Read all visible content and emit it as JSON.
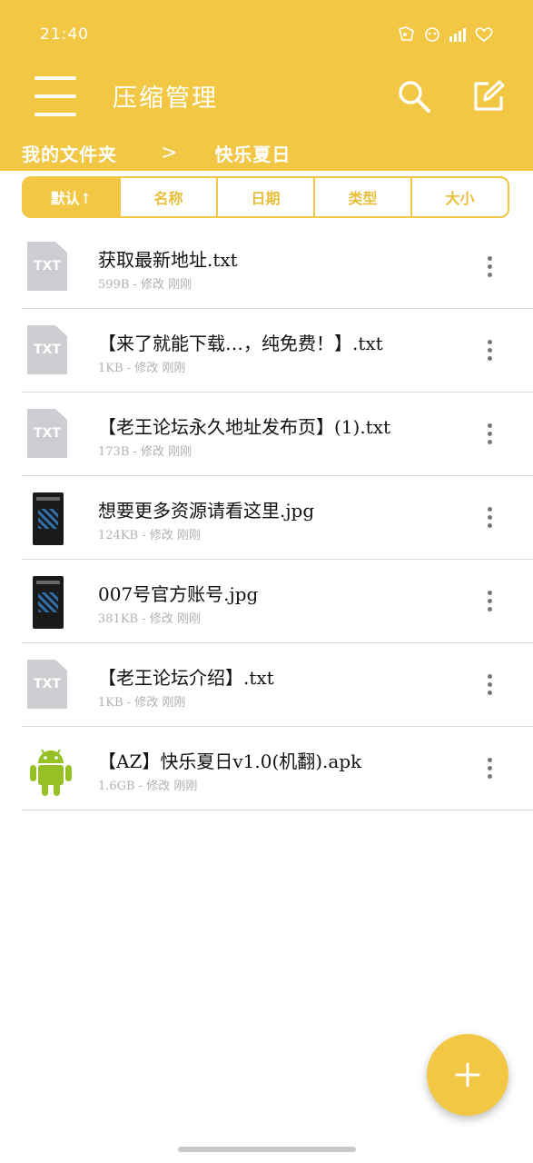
{
  "status": {
    "time": "21:40"
  },
  "app": {
    "title": "压缩管理"
  },
  "breadcrumb": {
    "root": "我的文件夹",
    "separator": ">",
    "current": "快乐夏日"
  },
  "sort_tabs": [
    {
      "label": "默认↑",
      "active": true
    },
    {
      "label": "名称",
      "active": false
    },
    {
      "label": "日期",
      "active": false
    },
    {
      "label": "类型",
      "active": false
    },
    {
      "label": "大小",
      "active": false
    }
  ],
  "files": [
    {
      "name": "获取最新地址.txt",
      "meta": "599B - 修改 刚刚",
      "icon": "txt-file-icon",
      "icon_label": "TXT"
    },
    {
      "name": "【来了就能下载…，纯免费！】.txt",
      "meta": "1KB - 修改 刚刚",
      "icon": "txt-file-icon",
      "icon_label": "TXT"
    },
    {
      "name": "【老王论坛永久地址发布页】(1).txt",
      "meta": "173B - 修改 刚刚",
      "icon": "txt-file-icon",
      "icon_label": "TXT"
    },
    {
      "name": "想要更多资源请看这里.jpg",
      "meta": "124KB - 修改 刚刚",
      "icon": "image-thumbnail-icon"
    },
    {
      "name": "007号官方账号.jpg",
      "meta": "381KB - 修改 刚刚",
      "icon": "image-thumbnail-icon"
    },
    {
      "name": "【老王论坛介绍】.txt",
      "meta": "1KB - 修改 刚刚",
      "icon": "txt-file-icon",
      "icon_label": "TXT"
    },
    {
      "name": "【AZ】快乐夏日v1.0(机翻).apk",
      "meta": "1.6GB - 修改 刚刚",
      "icon": "android-apk-icon"
    }
  ],
  "fab": {
    "icon": "plus-icon"
  },
  "colors": {
    "accent": "#F2C744",
    "android_green": "#97C024"
  }
}
